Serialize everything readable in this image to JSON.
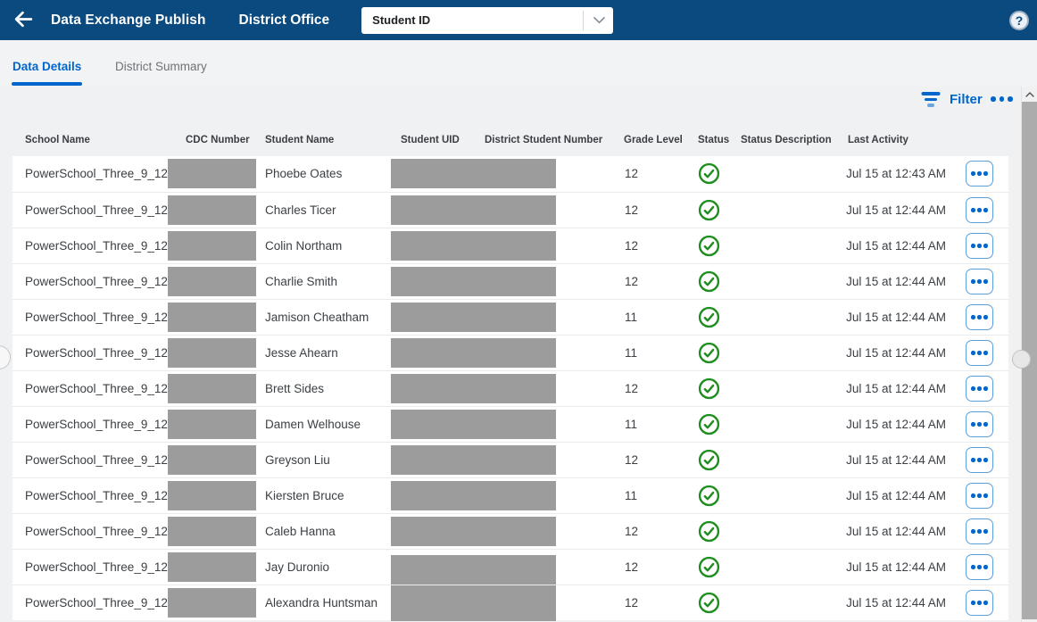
{
  "topbar": {
    "title": "Data Exchange Publish",
    "context": "District Office",
    "selector_value": "Student ID",
    "help_label": "?"
  },
  "tabs": [
    {
      "label": "Data Details",
      "active": true
    },
    {
      "label": "District Summary",
      "active": false
    }
  ],
  "toolbar": {
    "filter_label": "Filter"
  },
  "icons": {
    "back": "arrow-left",
    "selector": "chevron-down",
    "help": "question-mark-circle",
    "filter": "filter-lines",
    "more": "ellipsis",
    "status_success": "check-circle",
    "row_actions": "ellipsis",
    "scroll_up": "chevron-up"
  },
  "table": {
    "columns": [
      "School Name",
      "CDC Number",
      "Student Name",
      "Student UID",
      "District Student Number",
      "Grade Level",
      "Status",
      "Status Description",
      "Last Activity"
    ],
    "rows": [
      {
        "school": "PowerSchool_Three_9_12",
        "cdc_masked": true,
        "student": "Phoebe Oates",
        "uid_masked": true,
        "grade": "12",
        "status": "success",
        "status_description": "",
        "last_activity": "Jul 15 at 12:43 AM"
      },
      {
        "school": "PowerSchool_Three_9_12",
        "cdc_masked": true,
        "student": "Charles Ticer",
        "uid_masked": true,
        "grade": "12",
        "status": "success",
        "status_description": "",
        "last_activity": "Jul 15 at 12:44 AM"
      },
      {
        "school": "PowerSchool_Three_9_12",
        "cdc_masked": true,
        "student": "Colin Northam",
        "uid_masked": true,
        "grade": "12",
        "status": "success",
        "status_description": "",
        "last_activity": "Jul 15 at 12:44 AM"
      },
      {
        "school": "PowerSchool_Three_9_12",
        "cdc_masked": true,
        "student": "Charlie Smith",
        "uid_masked": true,
        "grade": "12",
        "status": "success",
        "status_description": "",
        "last_activity": "Jul 15 at 12:44 AM"
      },
      {
        "school": "PowerSchool_Three_9_12",
        "cdc_masked": true,
        "student": "Jamison Cheatham",
        "uid_masked": true,
        "grade": "11",
        "status": "success",
        "status_description": "",
        "last_activity": "Jul 15 at 12:44 AM"
      },
      {
        "school": "PowerSchool_Three_9_12",
        "cdc_masked": true,
        "student": "Jesse Ahearn",
        "uid_masked": true,
        "grade": "11",
        "status": "success",
        "status_description": "",
        "last_activity": "Jul 15 at 12:44 AM"
      },
      {
        "school": "PowerSchool_Three_9_12",
        "cdc_masked": true,
        "student": "Brett Sides",
        "uid_masked": true,
        "grade": "12",
        "status": "success",
        "status_description": "",
        "last_activity": "Jul 15 at 12:44 AM"
      },
      {
        "school": "PowerSchool_Three_9_12",
        "cdc_masked": true,
        "student": "Damen Welhouse",
        "uid_masked": true,
        "grade": "11",
        "status": "success",
        "status_description": "",
        "last_activity": "Jul 15 at 12:44 AM"
      },
      {
        "school": "PowerSchool_Three_9_12",
        "cdc_masked": true,
        "student": "Greyson Liu",
        "uid_masked": true,
        "grade": "12",
        "status": "success",
        "status_description": "",
        "last_activity": "Jul 15 at 12:44 AM"
      },
      {
        "school": "PowerSchool_Three_9_12",
        "cdc_masked": true,
        "student": "Kiersten Bruce",
        "uid_masked": true,
        "grade": "11",
        "status": "success",
        "status_description": "",
        "last_activity": "Jul 15 at 12:44 AM"
      },
      {
        "school": "PowerSchool_Three_9_12",
        "cdc_masked": true,
        "student": "Caleb Hanna",
        "uid_masked": true,
        "grade": "12",
        "status": "success",
        "status_description": "",
        "last_activity": "Jul 15 at 12:44 AM"
      },
      {
        "school": "PowerSchool_Three_9_12",
        "cdc_masked": true,
        "student": "Jay Duronio",
        "uid_masked": true,
        "grade": "12",
        "status": "success",
        "status_description": "",
        "last_activity": "Jul 15 at 12:44 AM"
      },
      {
        "school": "PowerSchool_Three_9_12",
        "cdc_masked": true,
        "student": "Alexandra Huntsman",
        "uid_masked": true,
        "grade": "12",
        "status": "success",
        "status_description": "",
        "last_activity": "Jul 15 at 12:44 AM"
      }
    ]
  },
  "colors": {
    "topbar_bg": "#0B4A7E",
    "accent_blue": "#0066CC",
    "success_green": "#1E8E1E",
    "redaction_gray": "#9C9C9C",
    "page_bg": "#F0F1F3"
  }
}
